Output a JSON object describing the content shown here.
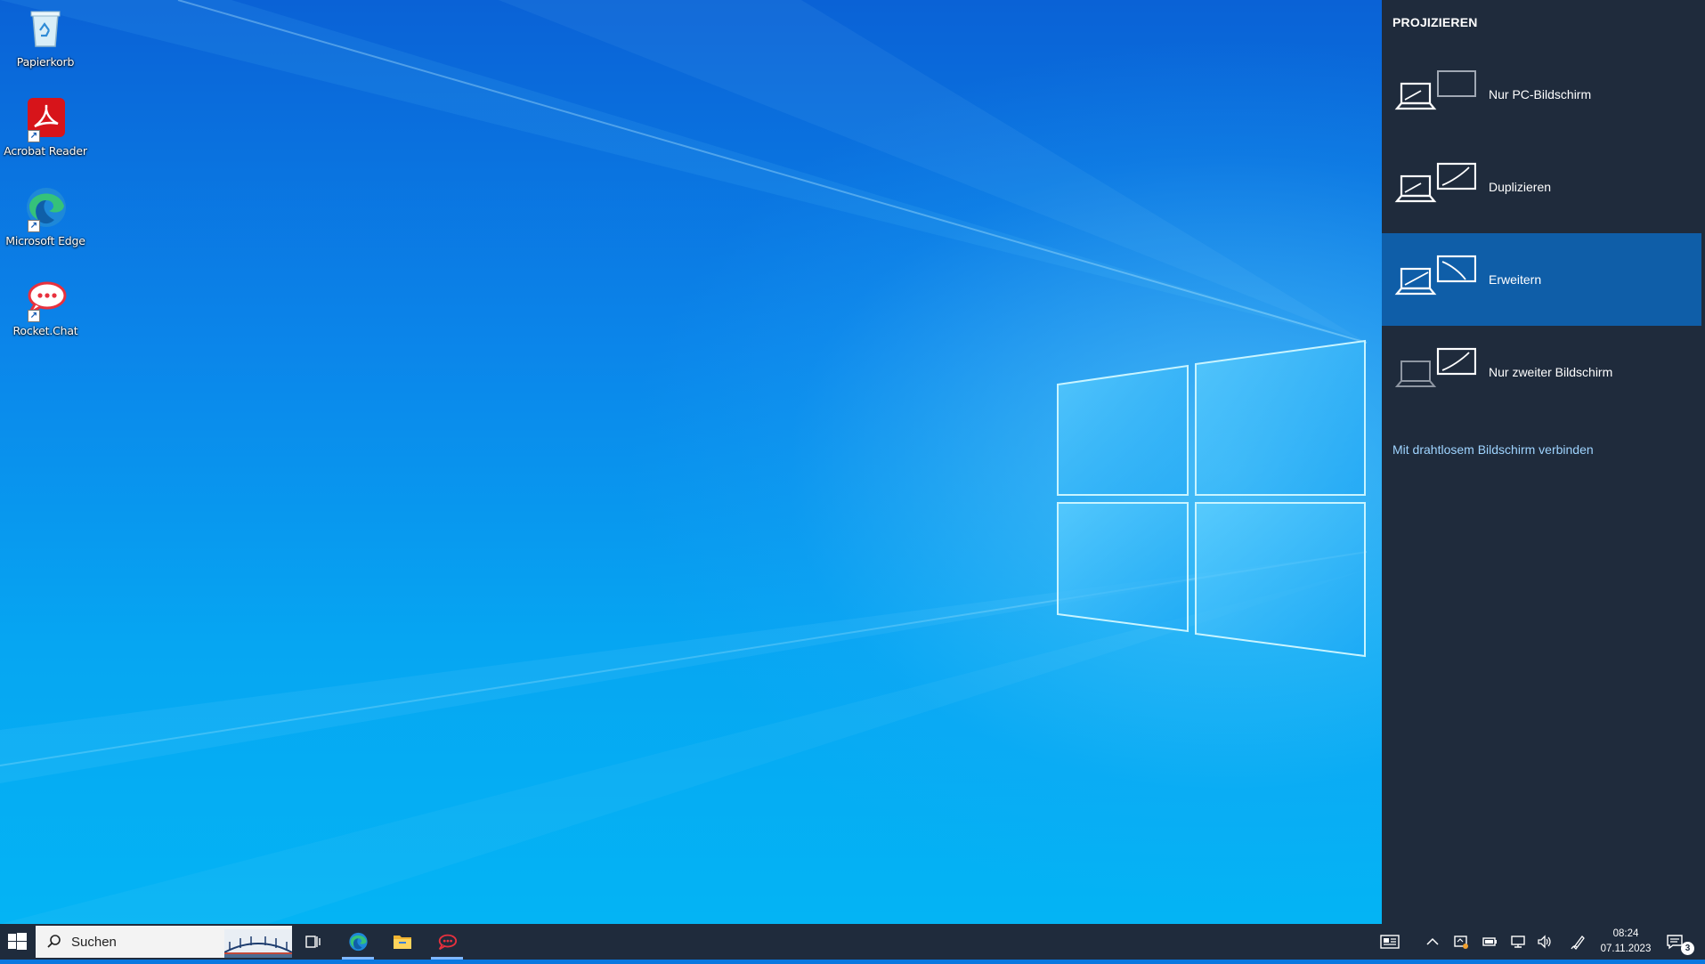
{
  "desktop": {
    "icons": [
      {
        "label": "Papierkorb",
        "icon": "recycle-bin-icon"
      },
      {
        "label": "Acrobat Reader",
        "icon": "acrobat-reader-icon"
      },
      {
        "label": "Microsoft Edge",
        "icon": "edge-icon"
      },
      {
        "label": "Rocket.Chat",
        "icon": "rocket-chat-icon"
      }
    ]
  },
  "project_panel": {
    "title": "PROJIZIEREN",
    "options": [
      {
        "label": "Nur PC-Bildschirm",
        "selected": false
      },
      {
        "label": "Duplizieren",
        "selected": false
      },
      {
        "label": "Erweitern",
        "selected": true
      },
      {
        "label": "Nur zweiter Bildschirm",
        "selected": false
      }
    ],
    "wireless_link": "Mit drahtlosem Bildschirm verbinden",
    "colors": {
      "background": "#1f2b3c",
      "selected": "#0f5ea8",
      "link": "#9fd4ff"
    }
  },
  "taskbar": {
    "search_placeholder": "Suchen",
    "pinned": [
      "task-view-icon",
      "edge-icon",
      "file-explorer-icon",
      "rocket-chat-icon"
    ],
    "tray": [
      "news-icon",
      "chevron-up-icon",
      "meet-now-icon",
      "battery-icon",
      "network-icon",
      "volume-icon",
      "pen-icon"
    ],
    "clock": {
      "time": "08:24",
      "date": "07.11.2023"
    },
    "notifications_count": "3"
  }
}
